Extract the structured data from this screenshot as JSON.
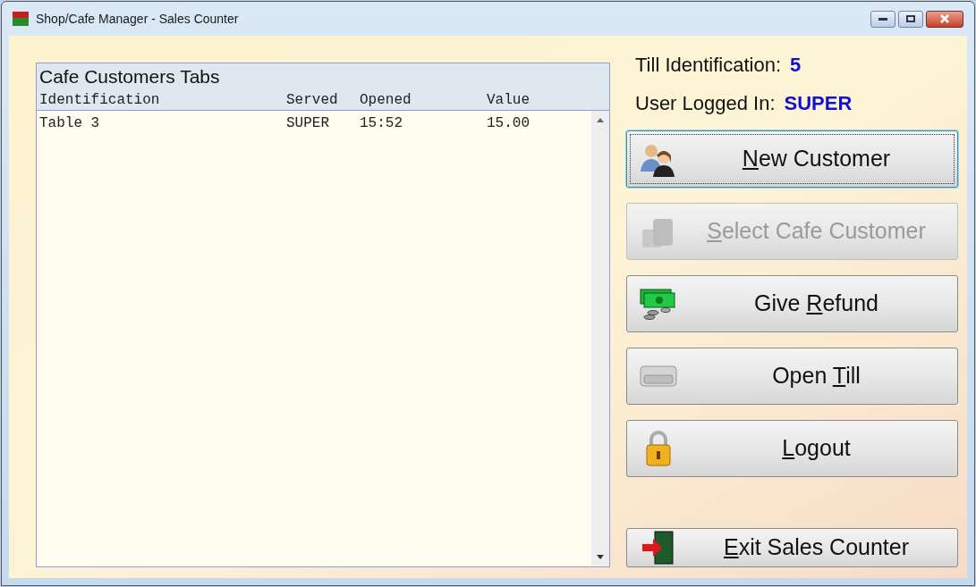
{
  "window": {
    "title": "Shop/Cafe Manager  -  Sales Counter"
  },
  "tabs_panel": {
    "title": "Cafe Customers Tabs",
    "columns": [
      "Identification",
      "Served",
      "Opened",
      "Value"
    ],
    "rows": [
      {
        "cells": [
          "Table 3",
          "SUPER",
          "15:52",
          "15.00"
        ]
      }
    ]
  },
  "info": [
    {
      "label": "Till Identification:",
      "value": "5"
    },
    {
      "label": "User Logged In:",
      "value": "SUPER"
    }
  ],
  "buttons": [
    {
      "kind": "people",
      "access_key": "N",
      "label_after": "ew Customer",
      "disabled": false,
      "focused": true
    },
    {
      "kind": "blocks",
      "access_key": "S",
      "label_after": "elect Cafe Customer",
      "disabled": true,
      "focused": false
    },
    {
      "kind": "money",
      "label_before": "Give ",
      "access_key": "R",
      "label_after": "efund",
      "disabled": false,
      "focused": false
    },
    {
      "kind": "drawer",
      "label_before": "Open ",
      "access_key": "T",
      "label_after": "ill",
      "disabled": false,
      "focused": false
    },
    {
      "kind": "lock",
      "access_key": "L",
      "label_after": "ogout",
      "disabled": false,
      "focused": false
    },
    {
      "kind": "exit",
      "access_key": "E",
      "label_after": "xit Sales Counter",
      "disabled": false,
      "focused": false
    }
  ]
}
